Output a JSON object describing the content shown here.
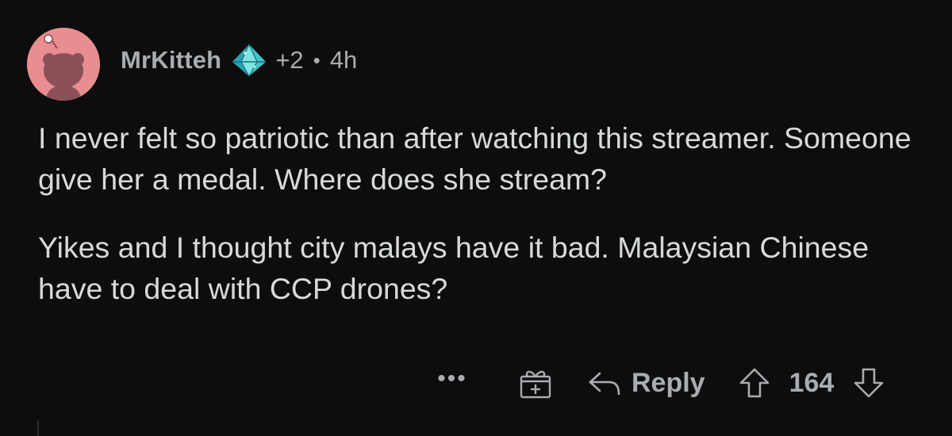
{
  "comment": {
    "username": "MrKitteh",
    "award_icon": "diamond-award-icon",
    "award_count": "+2",
    "separator": "•",
    "timestamp": "4h",
    "paragraphs": [
      "I never felt so patriotic than after watching this streamer. Someone give her a medal. Where does she stream?",
      "Yikes and I thought city malays have it bad. Malaysian Chinese have to deal with CCP drones?"
    ],
    "actions": {
      "more": "•••",
      "gift_icon": "gift-icon",
      "reply_label": "Reply",
      "vote_count": "164"
    },
    "colors": {
      "background": "#0d0d0d",
      "avatar": "#e88e91",
      "text": "#d7dadc",
      "meta": "#a9acb0"
    }
  }
}
